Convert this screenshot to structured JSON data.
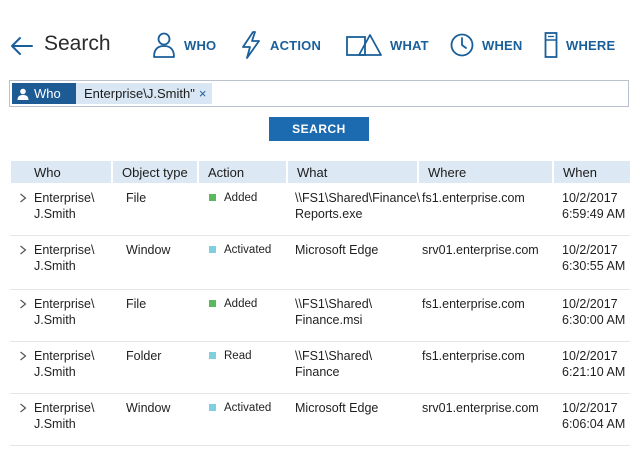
{
  "header": {
    "title": "Search",
    "nav": [
      {
        "label": "WHO",
        "icon": "user-icon"
      },
      {
        "label": "ACTION",
        "icon": "lightning-icon"
      },
      {
        "label": "WHAT",
        "icon": "shapes-icon"
      },
      {
        "label": "WHEN",
        "icon": "clock-icon"
      },
      {
        "label": "WHERE",
        "icon": "server-icon"
      }
    ]
  },
  "filter": {
    "label": "Who",
    "value": "Enterprise\\J.Smith\"",
    "remove": "×"
  },
  "search_button": "SEARCH",
  "table": {
    "columns": [
      "Who",
      "Object type",
      "Action",
      "What",
      "Where",
      "When"
    ],
    "rows": [
      {
        "who1": "Enterprise\\",
        "who2": "J.Smith",
        "type": "File",
        "action": "Added",
        "action_color": "#5cb85c",
        "what1": "\\\\FS1\\Shared\\Finance\\",
        "what2": "Reports.exe",
        "where": "fs1.enterprise.com",
        "when1": "10/2/2017",
        "when2": "6:59:49 AM"
      },
      {
        "who1": "Enterprise\\",
        "who2": "J.Smith",
        "type": "Window",
        "action": "Activated",
        "action_color": "#7ecfe0",
        "what1": "Microsoft Edge",
        "what2": "",
        "where": "srv01.enterprise.com",
        "when1": "10/2/2017",
        "when2": "6:30:55 AM"
      },
      {
        "who1": "Enterprise\\",
        "who2": "J.Smith",
        "type": "File",
        "action": "Added",
        "action_color": "#5cb85c",
        "what1": "\\\\FS1\\Shared\\",
        "what2": "Finance.msi",
        "where": "fs1.enterprise.com",
        "when1": "10/2/2017",
        "when2": "6:30:00 AM"
      },
      {
        "who1": "Enterprise\\",
        "who2": "J.Smith",
        "type": "Folder",
        "action": "Read",
        "action_color": "#7ecfe0",
        "what1": "\\\\FS1\\Shared\\",
        "what2": "Finance",
        "where": "fs1.enterprise.com",
        "when1": "10/2/2017",
        "when2": "6:21:10 AM"
      },
      {
        "who1": "Enterprise\\",
        "who2": "J.Smith",
        "type": "Window",
        "action": "Activated",
        "action_color": "#7ecfe0",
        "what1": "Microsoft Edge",
        "what2": "",
        "where": "srv01.enterprise.com",
        "when1": "10/2/2017",
        "when2": "6:06:04 AM"
      }
    ]
  },
  "colors": {
    "accent": "#1a5f9a",
    "chip": "#1c5b94",
    "button": "#1c6bb0",
    "header_row": "#dce8f3"
  }
}
